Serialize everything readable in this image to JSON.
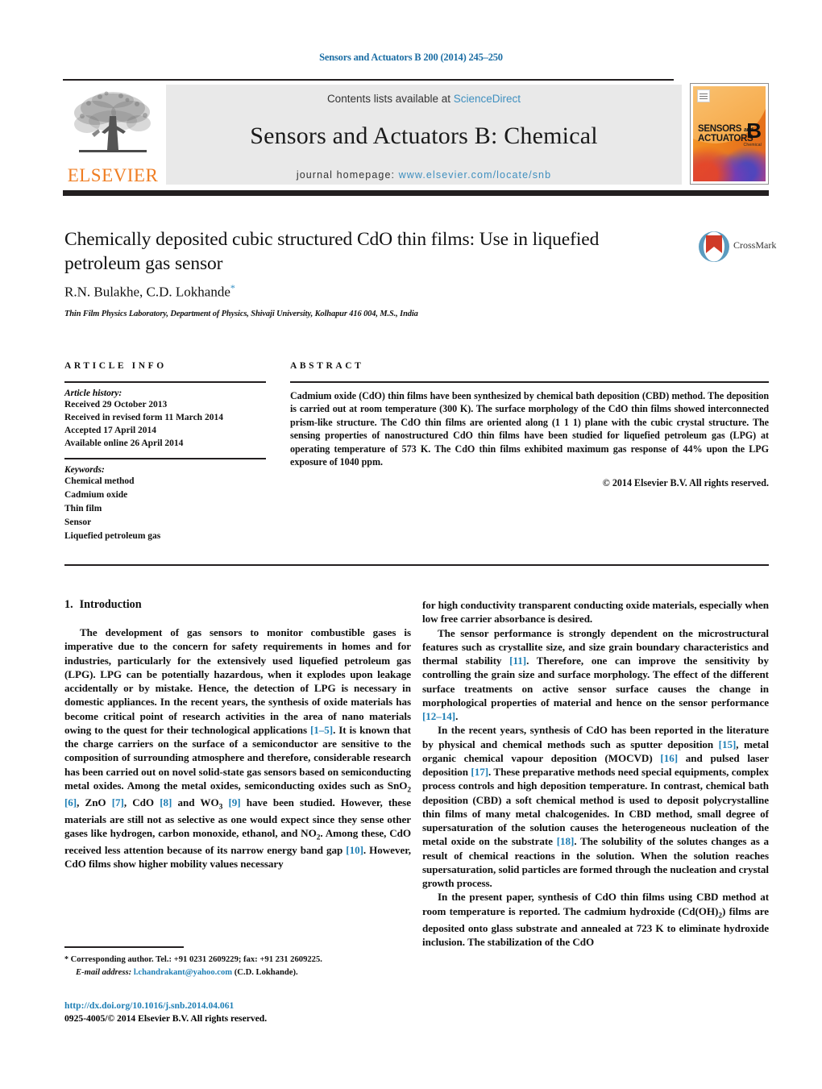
{
  "running_head": "Sensors and Actuators B 200 (2014) 245–250",
  "header": {
    "contents_prefix": "Contents lists available at ",
    "sciencedirect": "ScienceDirect",
    "journal_title": "Sensors and Actuators B: Chemical",
    "homepage_prefix": "journal homepage: ",
    "homepage_url": "www.elsevier.com/locate/snb",
    "publisher_logo_text": "ELSEVIER",
    "cover": {
      "line1": "SENSORS",
      "line1_small": "and",
      "line2": "ACTUATORS",
      "letter": "B",
      "sub": "Chemical"
    }
  },
  "article": {
    "title": "Chemically deposited cubic structured CdO thin films: Use in liquefied petroleum gas sensor",
    "authors": "R.N. Bulakhe, C.D. Lokhande",
    "author_star": "*",
    "affiliation": "Thin Film Physics Laboratory, Department of Physics, Shivaji University, Kolhapur 416 004, M.S., India",
    "crossmark_label": "CrossMark"
  },
  "article_info": {
    "heading": "ARTICLE INFO",
    "history_label": "Article history:",
    "history": [
      "Received 29 October 2013",
      "Received in revised form 11 March 2014",
      "Accepted 17 April 2014",
      "Available online 26 April 2014"
    ],
    "keywords_label": "Keywords:",
    "keywords": [
      "Chemical method",
      "Cadmium oxide",
      "Thin film",
      "Sensor",
      "Liquefied petroleum gas"
    ]
  },
  "abstract": {
    "heading": "ABSTRACT",
    "text": "Cadmium oxide (CdO) thin films have been synthesized by chemical bath deposition (CBD) method. The deposition is carried out at room temperature (300 K). The surface morphology of the CdO thin films showed interconnected prism-like structure. The CdO thin films are oriented along (1 1 1) plane with the cubic crystal structure. The sensing properties of nanostructured CdO thin films have been studied for liquefied petroleum gas (LPG) at operating temperature of 573 K. The CdO thin films exhibited maximum gas response of 44% upon the LPG exposure of 1040 ppm.",
    "copyright": "© 2014 Elsevier B.V. All rights reserved."
  },
  "body": {
    "section_number": "1.",
    "section_title": "Introduction",
    "left": {
      "p1_a": "The development of gas sensors to monitor combustible gases is imperative due to the concern for safety requirements in homes and for industries, particularly for the extensively used liquefied petroleum gas (LPG). LPG can be potentially hazardous, when it explodes upon leakage accidentally or by mistake. Hence, the detection of LPG is necessary in domestic appliances. In the recent years, the synthesis of oxide materials has become critical point of research activities in the area of nano materials owing to the quest for their technological applications ",
      "ref_1_5": "[1–5]",
      "p1_b": ". It is known that the charge carriers on the surface of a semiconductor are sensitive to the composition of surrounding atmosphere and therefore, considerable research has been carried out on novel solid-state gas sensors based on semiconducting metal oxides. Among the metal oxides, semiconducting oxides such as SnO",
      "sub_2": "2",
      "p1_c": " ",
      "ref_6": "[6]",
      "p1_d": ", ZnO ",
      "ref_7": "[7]",
      "p1_e": ", CdO ",
      "ref_8": "[8]",
      "p1_f": " and WO",
      "sub_3": "3",
      "p1_g": " ",
      "ref_9": "[9]",
      "p1_h": " have been studied. However, these materials are still not as selective as one would expect since they sense other gases like hydrogen, carbon monoxide, ethanol, and NO",
      "sub_2b": "2",
      "p1_i": ". Among these, CdO received less attention because of its narrow energy band gap ",
      "ref_10": "[10]",
      "p1_j": ". However, CdO films show higher mobility values necessary"
    },
    "right": {
      "p1_cont": "for high conductivity transparent conducting oxide materials, especially when low free carrier absorbance is desired.",
      "p2_a": "The sensor performance is strongly dependent on the microstructural features such as crystallite size, and size grain boundary characteristics and thermal stability ",
      "ref_11": "[11]",
      "p2_b": ". Therefore, one can improve the sensitivity by controlling the grain size and surface morphology. The effect of the different surface treatments on active sensor surface causes the change in morphological properties of material and hence on the sensor performance ",
      "ref_12_14": "[12–14]",
      "p2_c": ".",
      "p3_a": "In the recent years, synthesis of CdO has been reported in the literature by physical and chemical methods such as sputter deposition ",
      "ref_15": "[15]",
      "p3_b": ", metal organic chemical vapour deposition (MOCVD) ",
      "ref_16": "[16]",
      "p3_c": " and pulsed laser deposition ",
      "ref_17": "[17]",
      "p3_d": ". These preparative methods need special equipments, complex process controls and high deposition temperature. In contrast, chemical bath deposition (CBD) a soft chemical method is used to deposit polycrystalline thin films of many metal chalcogenides. In CBD method, small degree of supersaturation of the solution causes the heterogeneous nucleation of the metal oxide on the substrate ",
      "ref_18": "[18]",
      "p3_e": ". The solubility of the solutes changes as a result of chemical reactions in the solution. When the solution reaches supersaturation, solid particles are formed through the nucleation and crystal growth process.",
      "p4_a": "In the present paper, synthesis of CdO thin films using CBD method at room temperature is reported. The cadmium hydroxide (Cd(OH)",
      "sub_2": "2",
      "p4_b": ") films are deposited onto glass substrate and annealed at 723 K to eliminate hydroxide inclusion. The stabilization of the CdO"
    }
  },
  "footnotes": {
    "star": "*",
    "corresponding": " Corresponding author. Tel.: +91 0231 2609229; fax: +91 231 2609225.",
    "email_label": "E-mail address:",
    "email": "l.chandrakant@yahoo.com",
    "email_suffix": " (C.D. Lokhande).",
    "doi": "http://dx.doi.org/10.1016/j.snb.2014.04.061",
    "issn_line": "0925-4005/© 2014 Elsevier B.V. All rights reserved."
  },
  "colors": {
    "link": "#1f7fb5",
    "sciencedirect": "#3f8fbf",
    "elsevier_orange": "#ef7d22",
    "rule": "#231f20"
  }
}
